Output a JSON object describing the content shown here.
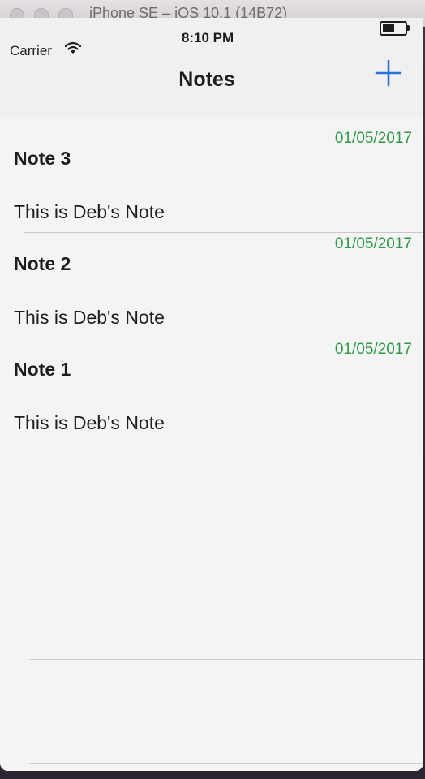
{
  "window": {
    "title": "iPhone SE – iOS 10.1 (14B72)"
  },
  "status_bar": {
    "carrier": "Carrier",
    "time": "8:10 PM",
    "wifi_icon": "wifi-icon",
    "battery_icon": "battery-icon"
  },
  "nav": {
    "title": "Notes",
    "add_icon": "plus-icon",
    "accent_color": "#2f6fd6"
  },
  "notes": [
    {
      "title": "Note 3",
      "date": "01/05/2017",
      "body": "This is Deb's Note"
    },
    {
      "title": "Note 2",
      "date": "01/05/2017",
      "body": "This is Deb's Note"
    },
    {
      "title": "Note 1",
      "date": "01/05/2017",
      "body": "This is Deb's Note"
    }
  ],
  "colors": {
    "date_text": "#2e9a45",
    "separator": "#c8c7cc"
  }
}
